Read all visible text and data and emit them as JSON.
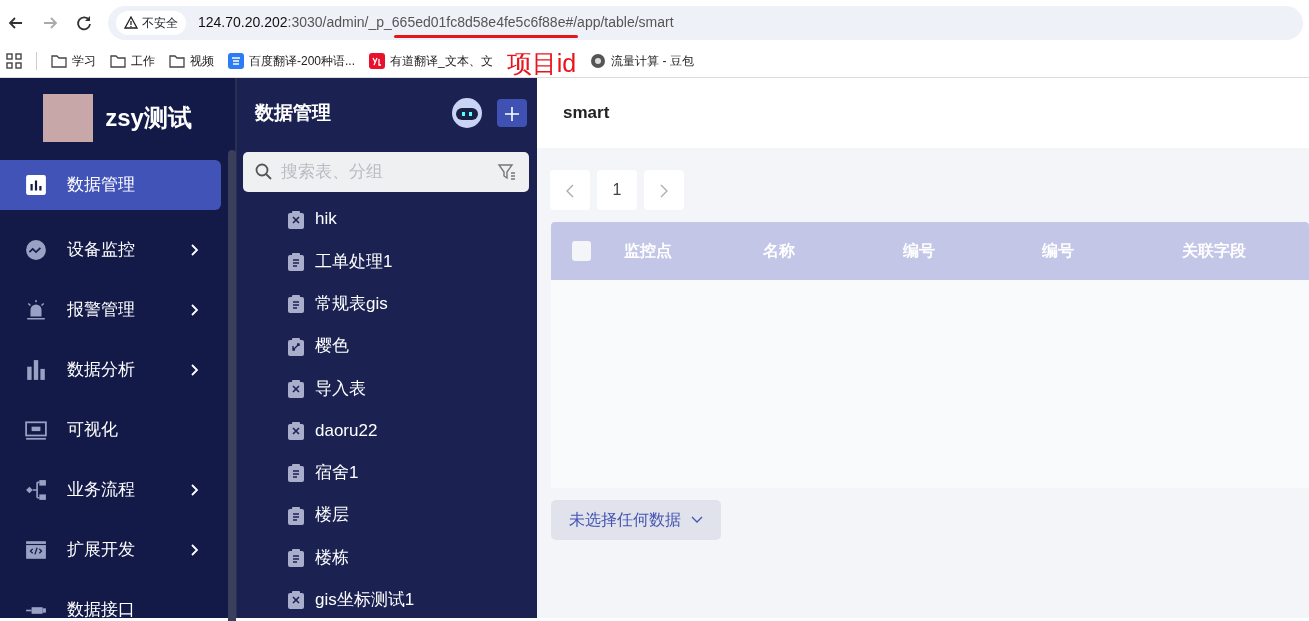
{
  "browser": {
    "security": "不安全",
    "url_host": "124.70.20.202",
    "url_rest": ":3030/admin/_p_665ed01fc8d58e4fe5c6f88e#/app/table/smart",
    "bookmarks": [
      {
        "kind": "folder",
        "label": "学习"
      },
      {
        "kind": "folder",
        "label": "工作"
      },
      {
        "kind": "folder",
        "label": "视频"
      },
      {
        "kind": "translate",
        "label": "百度翻译-200种语..."
      },
      {
        "kind": "yd",
        "label": "有道翻译_文本、文"
      },
      {
        "kind": "globe",
        "label": "流量计算 - 豆包"
      }
    ]
  },
  "annotation": {
    "text": "项目id"
  },
  "sidebar": {
    "app_name": "zsy测试",
    "items": [
      {
        "kind": "bars",
        "label": "数据管理",
        "submenu": false,
        "selected": true
      },
      {
        "kind": "monitor",
        "label": "设备监控",
        "submenu": true,
        "selected": false
      },
      {
        "kind": "alarm",
        "label": "报警管理",
        "submenu": true,
        "selected": false
      },
      {
        "kind": "chart",
        "label": "数据分析",
        "submenu": true,
        "selected": false
      },
      {
        "kind": "screen",
        "label": "可视化",
        "submenu": false,
        "selected": false
      },
      {
        "kind": "flow",
        "label": "业务流程",
        "submenu": true,
        "selected": false
      },
      {
        "kind": "code",
        "label": "扩展开发",
        "submenu": true,
        "selected": false
      },
      {
        "kind": "plug",
        "label": "数据接口",
        "submenu": false,
        "selected": false
      }
    ]
  },
  "panel": {
    "title": "数据管理",
    "search": {
      "placeholder": "搜索表、分组"
    },
    "tables": [
      {
        "kind": "tool",
        "label": "hik"
      },
      {
        "kind": "doc",
        "label": "工单处理1"
      },
      {
        "kind": "doc",
        "label": "常规表gis"
      },
      {
        "kind": "swap",
        "label": "樱色"
      },
      {
        "kind": "tool",
        "label": "导入表"
      },
      {
        "kind": "tool",
        "label": "daoru22"
      },
      {
        "kind": "doc",
        "label": "宿舍1"
      },
      {
        "kind": "doc",
        "label": "楼层"
      },
      {
        "kind": "doc",
        "label": "楼栋"
      },
      {
        "kind": "tool",
        "label": "gis坐标测试1"
      }
    ]
  },
  "main": {
    "title": "smart",
    "pages": [
      {
        "label": "1",
        "selected": false
      }
    ],
    "columns": [
      "监控点",
      "名称",
      "编号",
      "编号",
      "关联字段"
    ],
    "select_all": {
      "checked": false
    },
    "selection_button": "未选择任何数据"
  }
}
